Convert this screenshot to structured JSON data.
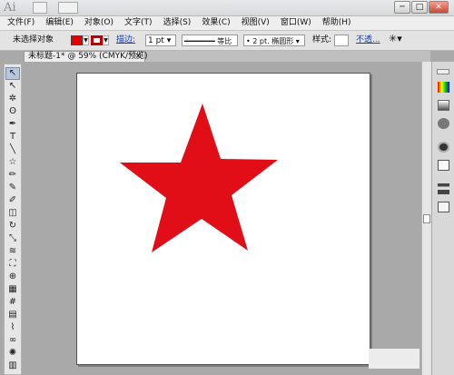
{
  "app": {
    "logo": "Ai"
  },
  "window": {
    "minimize": "─",
    "restore": "□",
    "close": "✕"
  },
  "menu": [
    "文件(F)",
    "编辑(E)",
    "对象(O)",
    "文字(T)",
    "选择(S)",
    "效果(C)",
    "视图(V)",
    "窗口(W)",
    "帮助(H)"
  ],
  "control": {
    "selection": "未选择对象",
    "stroke_label": "描边:",
    "stroke_weight": "1 pt",
    "profile": "等比",
    "brush": "2 pt. 椭圆形",
    "style_label": "样式:",
    "opacity_label": "不透...",
    "fill_color": "#e00000",
    "stroke_color": "#c00000"
  },
  "document": {
    "tab_title": "未标题-1* @ 59% (CMYK/预览)",
    "close": "×"
  },
  "tools": [
    {
      "name": "selection-tool",
      "glyph": "↖"
    },
    {
      "name": "direct-selection-tool",
      "glyph": "↖"
    },
    {
      "name": "magic-wand-tool",
      "glyph": "✲"
    },
    {
      "name": "lasso-tool",
      "glyph": "ʘ"
    },
    {
      "name": "pen-tool",
      "glyph": "✒"
    },
    {
      "name": "type-tool",
      "glyph": "T"
    },
    {
      "name": "line-tool",
      "glyph": "╲"
    },
    {
      "name": "star-tool",
      "glyph": "☆"
    },
    {
      "name": "paintbrush-tool",
      "glyph": "✏"
    },
    {
      "name": "pencil-tool",
      "glyph": "✎"
    },
    {
      "name": "blob-brush-tool",
      "glyph": "✐"
    },
    {
      "name": "eraser-tool",
      "glyph": "◫"
    },
    {
      "name": "rotate-tool",
      "glyph": "↻"
    },
    {
      "name": "scale-tool",
      "glyph": "⤡"
    },
    {
      "name": "warp-tool",
      "glyph": "≋"
    },
    {
      "name": "free-transform-tool",
      "glyph": "⛶"
    },
    {
      "name": "shape-builder-tool",
      "glyph": "⊕"
    },
    {
      "name": "perspective-grid-tool",
      "glyph": "▦"
    },
    {
      "name": "mesh-tool",
      "glyph": "#"
    },
    {
      "name": "gradient-tool",
      "glyph": "▤"
    },
    {
      "name": "eyedropper-tool",
      "glyph": "⌇"
    },
    {
      "name": "blend-tool",
      "glyph": "∞"
    },
    {
      "name": "symbol-sprayer-tool",
      "glyph": "✺"
    },
    {
      "name": "column-graph-tool",
      "glyph": "▥"
    }
  ],
  "artwork": {
    "shape": "star",
    "fill": "#e10e17"
  }
}
